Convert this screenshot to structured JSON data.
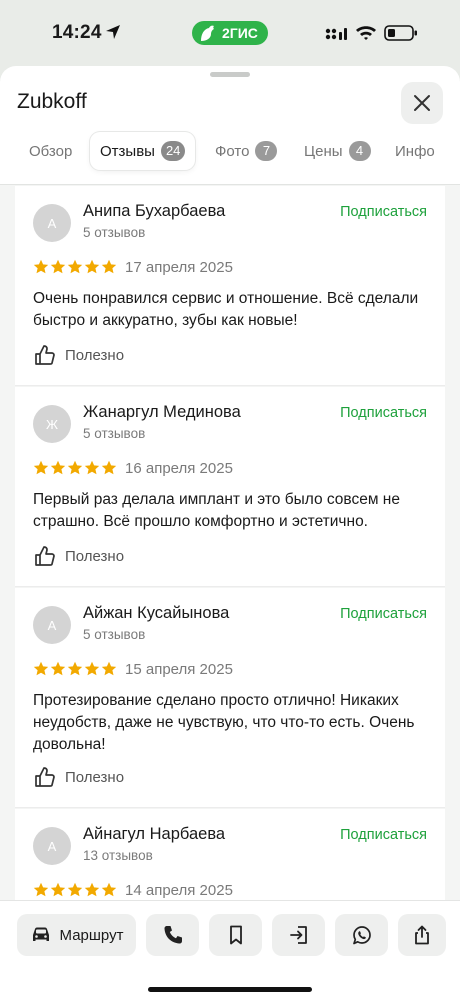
{
  "status_bar": {
    "time": "14:24",
    "brand": "2ГИС"
  },
  "header": {
    "title": "Zubkoff"
  },
  "tabs": [
    {
      "label": "Обзор",
      "badge": ""
    },
    {
      "label": "Отзывы",
      "badge": "24"
    },
    {
      "label": "Фото",
      "badge": "7"
    },
    {
      "label": "Цены",
      "badge": "4"
    },
    {
      "label": "Инфо",
      "badge": ""
    }
  ],
  "subscribe_label": "Подписаться",
  "useful_label": "Полезно",
  "reviews": [
    {
      "initial": "А",
      "author": "Анипа Бухарбаева",
      "count": "5 отзывов",
      "rating": 5,
      "date": "17 апреля 2025",
      "text": "Очень понравился сервис и отношение. Всё сделали быстро и аккуратно, зубы как новые!"
    },
    {
      "initial": "Ж",
      "author": "Жанаргул Мединова",
      "count": "5 отзывов",
      "rating": 5,
      "date": "16 апреля 2025",
      "text": "Первый раз делала имплант и это было совсем не страшно. Всё прошло комфортно и эстетично."
    },
    {
      "initial": "А",
      "author": "Айжан Кусайынова",
      "count": "5 отзывов",
      "rating": 5,
      "date": "15 апреля 2025",
      "text": "Протезирование сделано просто отлично! Никаких неудобств, даже не чувствую, что что-то есть. Очень довольна!"
    },
    {
      "initial": "А",
      "author": "Айнагул Нарбаева",
      "count": "13 отзывов",
      "rating": 5,
      "date": "14 апреля 2025",
      "text": ""
    }
  ],
  "bottom_bar": {
    "route_label": "Маршрут"
  },
  "colors": {
    "accent_green": "#1ea13c",
    "star": "#f2a900",
    "brand_green": "#2fb34a"
  }
}
